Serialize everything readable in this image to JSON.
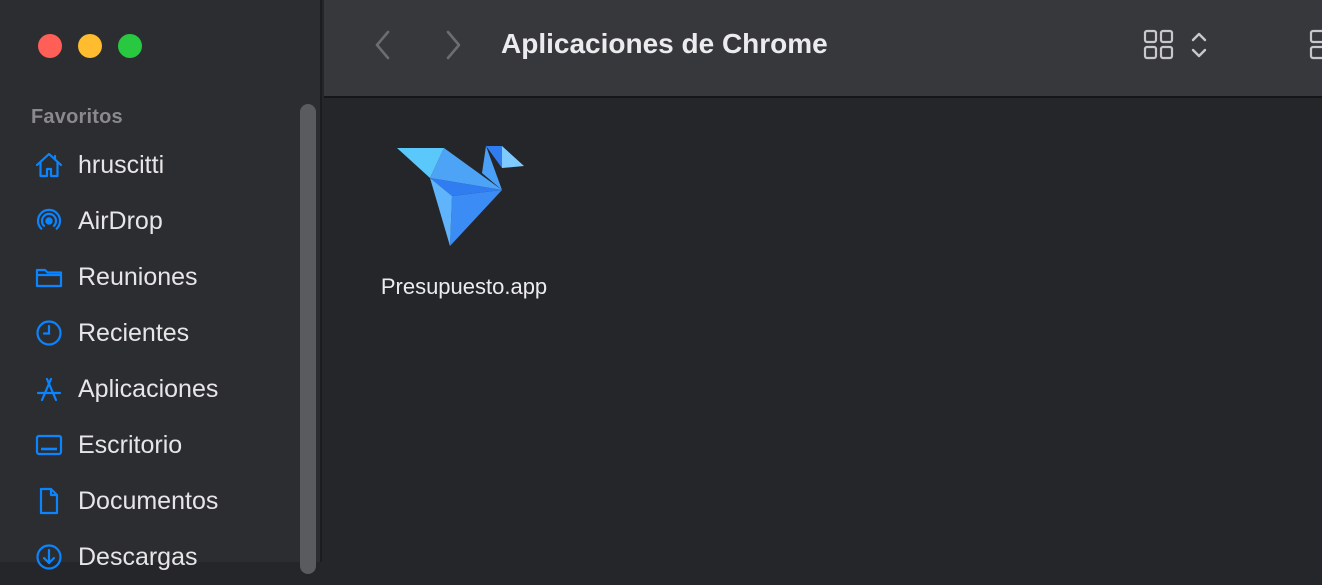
{
  "window": {
    "title": "Aplicaciones de Chrome"
  },
  "sidebar": {
    "section_label": "Favoritos",
    "items": [
      {
        "label": "hruscitti",
        "icon": "house-icon"
      },
      {
        "label": "AirDrop",
        "icon": "airdrop-icon"
      },
      {
        "label": "Reuniones",
        "icon": "folder-icon"
      },
      {
        "label": "Recientes",
        "icon": "clock-icon"
      },
      {
        "label": "Aplicaciones",
        "icon": "applications-icon"
      },
      {
        "label": "Escritorio",
        "icon": "desktop-icon"
      },
      {
        "label": "Documentos",
        "icon": "document-icon"
      },
      {
        "label": "Descargas",
        "icon": "download-icon"
      }
    ]
  },
  "content": {
    "files": [
      {
        "name": "Presupuesto.app",
        "icon": "origami-bird-app-icon"
      }
    ]
  },
  "colors": {
    "accent": "#0a84ff",
    "close": "#ff5f57",
    "minimize": "#febc2e",
    "maximize": "#28c840"
  }
}
